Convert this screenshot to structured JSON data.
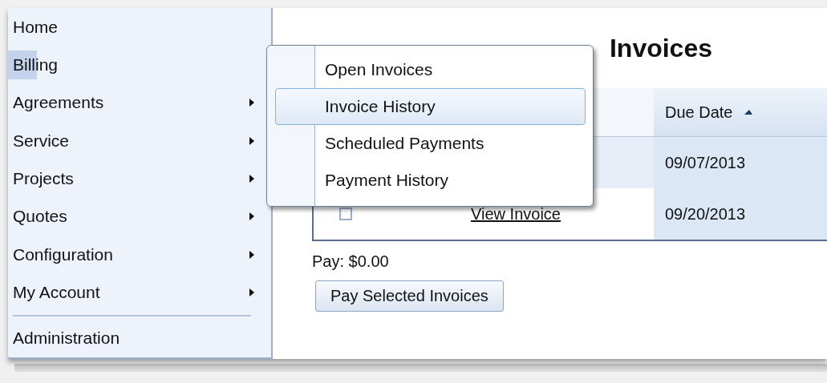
{
  "sidebar": {
    "items": [
      {
        "label": "Home",
        "selected": false,
        "has_submenu": false,
        "separator_before": false
      },
      {
        "label": "Billing",
        "selected": true,
        "has_submenu": false,
        "separator_before": false
      },
      {
        "label": "Agreements",
        "selected": false,
        "has_submenu": true,
        "separator_before": false
      },
      {
        "label": "Service",
        "selected": false,
        "has_submenu": true,
        "separator_before": false
      },
      {
        "label": "Projects",
        "selected": false,
        "has_submenu": true,
        "separator_before": false
      },
      {
        "label": "Quotes",
        "selected": false,
        "has_submenu": true,
        "separator_before": false
      },
      {
        "label": "Configuration",
        "selected": false,
        "has_submenu": true,
        "separator_before": false
      },
      {
        "label": "My Account",
        "selected": false,
        "has_submenu": true,
        "separator_before": false
      },
      {
        "label": "Administration",
        "selected": false,
        "has_submenu": false,
        "separator_before": true
      }
    ]
  },
  "submenu": {
    "items": [
      {
        "label": "Open Invoices",
        "selected": false
      },
      {
        "label": "Invoice History",
        "selected": true
      },
      {
        "label": "Scheduled Payments",
        "selected": false
      },
      {
        "label": "Payment History",
        "selected": false
      }
    ]
  },
  "page_title": "Invoices",
  "table": {
    "columns": [
      {
        "label": "Due Date",
        "sort_ascending": true
      }
    ],
    "rows": [
      {
        "due_date": "09/07/2013"
      },
      {
        "checkbox": {
          "checked": false
        },
        "link": "View Invoice",
        "due_date": "09/20/2013"
      }
    ]
  },
  "pay_total": "Pay: $0.00",
  "pay_button": "Pay Selected Invoices"
}
